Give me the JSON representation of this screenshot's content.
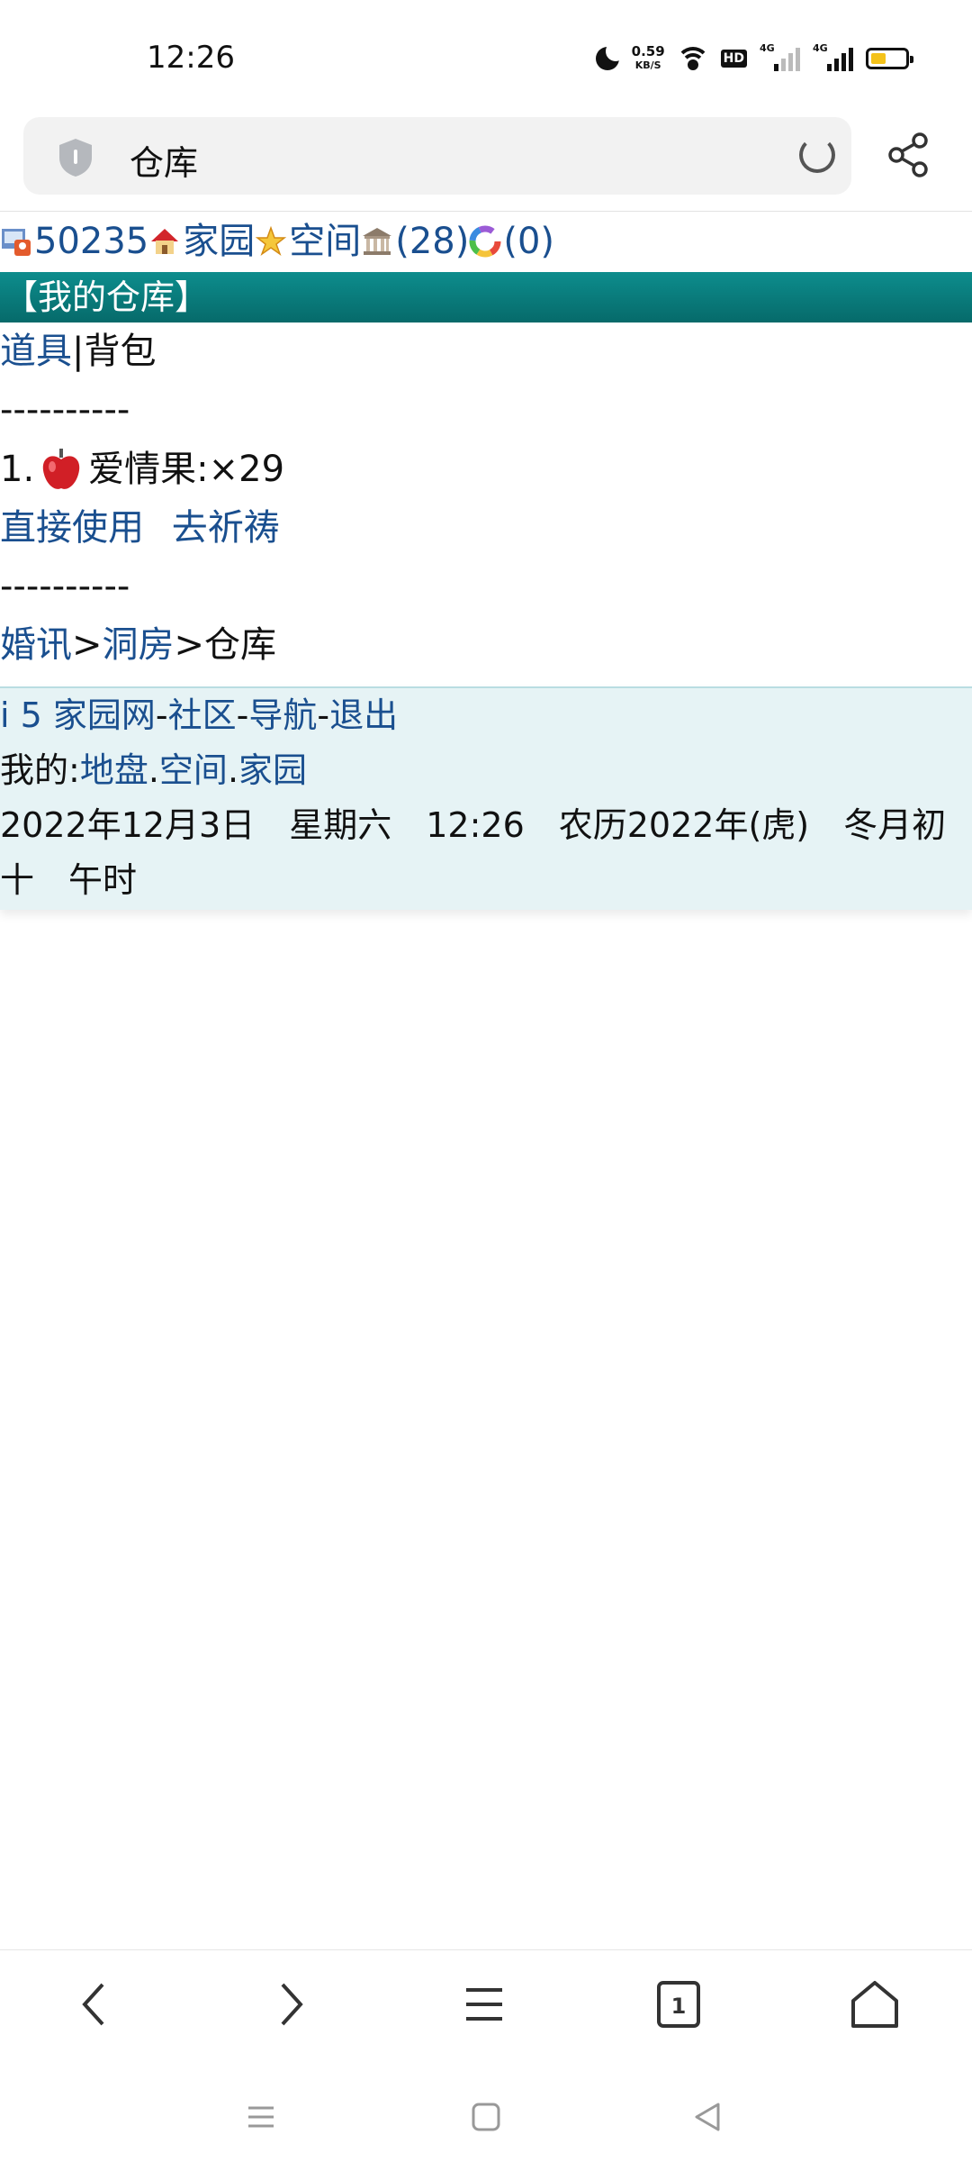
{
  "status_bar": {
    "time": "12:26",
    "net_speed_value": "0.59",
    "net_speed_unit": "KB/S",
    "hd_label": "HD",
    "signal1": "4G",
    "signal2": "4G",
    "battery_level": 0.45
  },
  "address_bar": {
    "text": "仓库"
  },
  "nav": {
    "user_id": "50235",
    "home": "家园",
    "space": "空间",
    "count1": "(28)",
    "count2": "(0)"
  },
  "page": {
    "title": "【我的仓库】",
    "tab_props": "道具",
    "tab_sep": "|",
    "tab_bag": "背包",
    "dashes": "----------",
    "item_index": "1.",
    "item_name": "爱情果:×29",
    "action_use": "直接使用",
    "action_pray": "去祈祷",
    "breadcrumb": {
      "part1": "婚讯",
      "sep": ">",
      "part2": "洞房",
      "current": "仓库"
    }
  },
  "footer": {
    "site": "i 5 家园网",
    "dash": "-",
    "community": "社区",
    "navigation": "导航",
    "logout": "退出",
    "mine_label": "我的:",
    "land": "地盘",
    "dot": ".",
    "space": "空间",
    "home": "家园",
    "date_text": "2022年12月3日　星期六　12:26　农历2022年(虎)　冬月初十　午时"
  },
  "colors": {
    "link": "#1a4f8f",
    "title_bar": "#0a7c7c",
    "footer_bg": "#e6f3f5",
    "battery": "#f4c21a"
  }
}
